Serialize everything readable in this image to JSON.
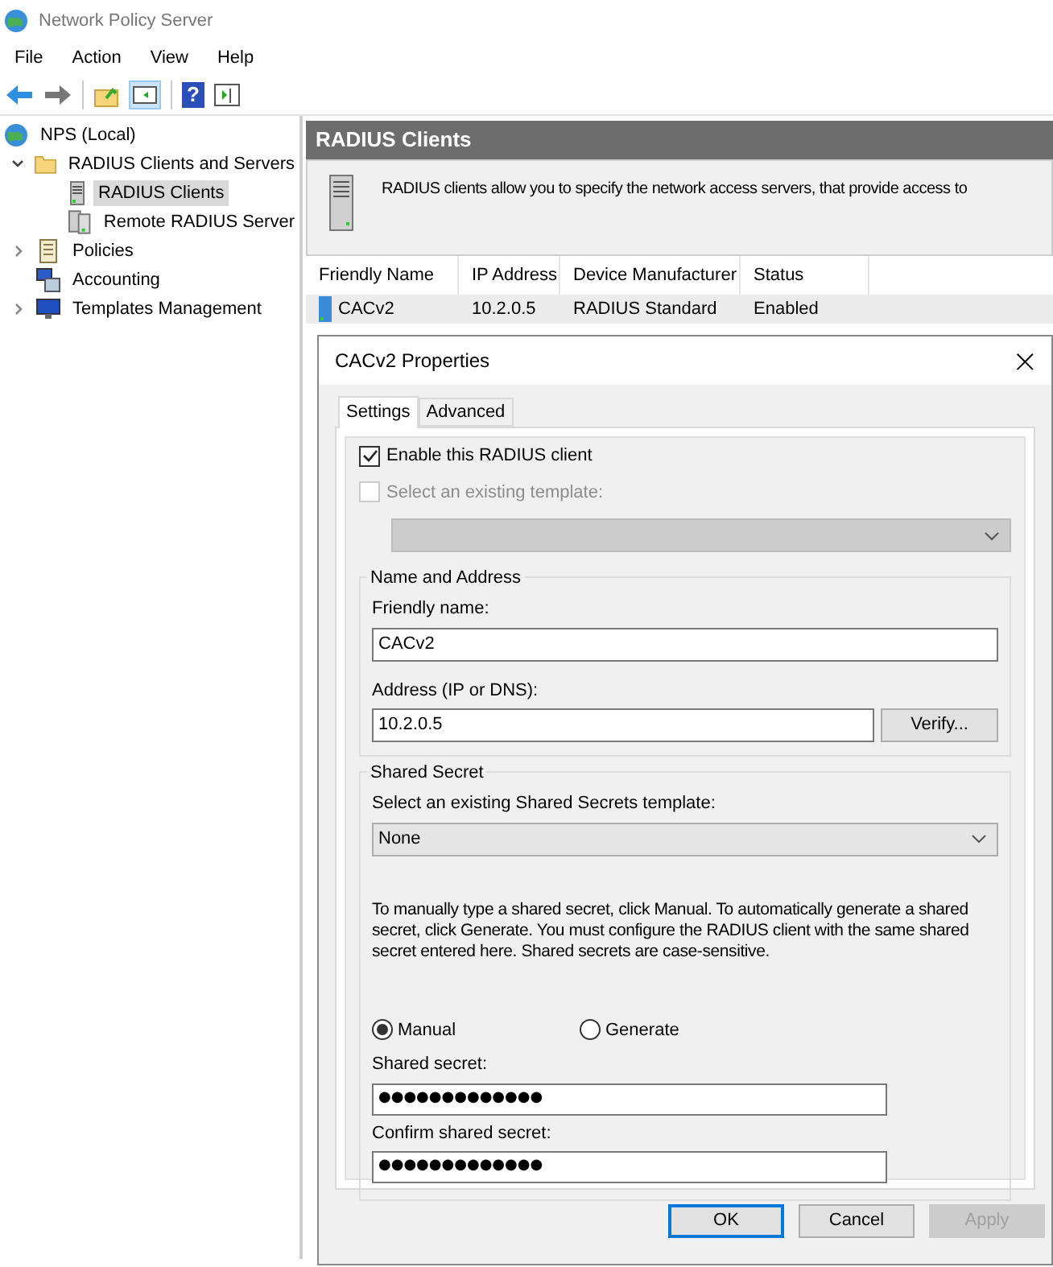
{
  "window": {
    "title": "Network Policy Server"
  },
  "menu": [
    "File",
    "Action",
    "View",
    "Help"
  ],
  "toolbar": {
    "help": "?"
  },
  "tree": [
    {
      "label": "NPS (Local)",
      "selected": false,
      "children": [
        {
          "label": "RADIUS Clients and Servers",
          "expanded": true,
          "selected": false,
          "children": [
            {
              "label": "RADIUS Clients",
              "selected": true
            },
            {
              "label": "Remote RADIUS Server",
              "selected": false
            }
          ]
        },
        {
          "label": "Policies",
          "expanded": false,
          "selected": false
        },
        {
          "label": "Accounting",
          "selected": false
        },
        {
          "label": "Templates Management",
          "expanded": false,
          "selected": false
        }
      ]
    }
  ],
  "pane": {
    "title": "RADIUS Clients",
    "description": "RADIUS clients allow you to specify the network access servers, that provide access to",
    "columns": [
      "Friendly Name",
      "IP Address",
      "Device Manufacturer",
      "Status"
    ],
    "rows": [
      {
        "cells": [
          "CACv2",
          "10.2.0.5",
          "RADIUS Standard",
          "Enabled"
        ],
        "selected": true
      }
    ]
  },
  "dialog": {
    "title": "CACv2 Properties",
    "close": "×",
    "tabs": [
      {
        "label": "Settings",
        "selected": true
      },
      {
        "label": "Advanced",
        "selected": false
      }
    ],
    "enable_checkbox": {
      "label": "Enable this RADIUS client",
      "checked": true,
      "disabled": false
    },
    "template_checkbox": {
      "label": "Select an existing template:",
      "checked": false,
      "disabled": true
    },
    "name_group": {
      "title": "Name and Address",
      "friendly_label": "Friendly name:",
      "friendly_value": "CACv2",
      "address_label": "Address (IP or DNS):",
      "address_value": "10.2.0.5",
      "verify": "Verify..."
    },
    "secret_group": {
      "title": "Shared Secret",
      "template_label": "Select an existing Shared Secrets template:",
      "template_value": "None",
      "help": "To manually type a shared secret, click Manual. To automatically generate a shared secret, click Generate. You must configure the RADIUS client with the same shared secret entered here. Shared secrets are case-sensitive.",
      "radios": [
        {
          "label": "Manual",
          "selected": true
        },
        {
          "label": "Generate",
          "selected": false
        }
      ],
      "secret_label": "Shared secret:",
      "secret_value": "●●●●●●●●●●●●●",
      "confirm_label": "Confirm shared secret:",
      "confirm_value": "●●●●●●●●●●●●●"
    },
    "buttons": [
      {
        "label": "OK",
        "kind": "default",
        "disabled": false
      },
      {
        "label": "Cancel",
        "kind": "normal",
        "disabled": false
      },
      {
        "label": "Apply",
        "kind": "normal",
        "disabled": true
      }
    ]
  }
}
